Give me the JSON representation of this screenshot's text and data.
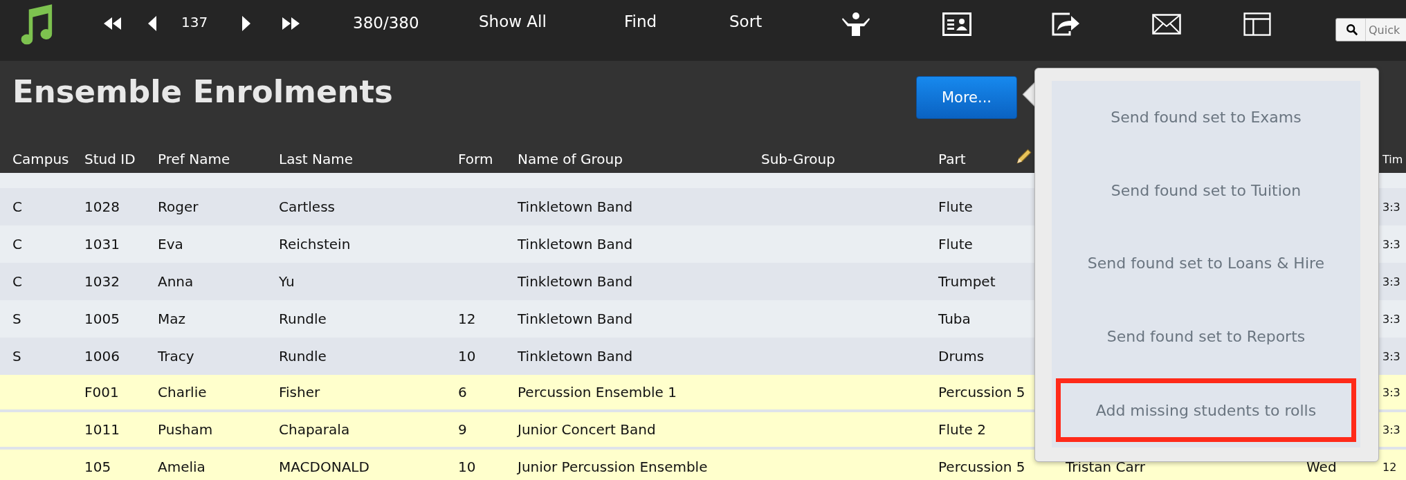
{
  "toolbar": {
    "record_number": "137",
    "record_count": "380/380",
    "buttons": [
      {
        "label": "Show All"
      },
      {
        "label": "Find"
      },
      {
        "label": "Sort"
      }
    ],
    "search": {
      "placeholder": "Quick"
    }
  },
  "header": {
    "title": "Ensemble Enrolments",
    "more_button": "More..."
  },
  "popover": {
    "items": [
      {
        "label": "Send found set to Exams",
        "highlighted": false
      },
      {
        "label": "Send found set to Tuition",
        "highlighted": false
      },
      {
        "label": "Send found set to Loans & Hire",
        "highlighted": false
      },
      {
        "label": "Send found set to Reports",
        "highlighted": false
      },
      {
        "label": "Add missing students to rolls",
        "highlighted": true
      }
    ]
  },
  "table": {
    "columns": [
      {
        "label": "Campus"
      },
      {
        "label": "Stud ID"
      },
      {
        "label": "Pref Name"
      },
      {
        "label": "Last Name"
      },
      {
        "label": "Form"
      },
      {
        "label": "Name of Group"
      },
      {
        "label": "Sub-Group"
      },
      {
        "label": "Part"
      },
      {
        "label": "Tim"
      }
    ],
    "rows": [
      {
        "flagged": false,
        "campus": "C",
        "stud_id": "1028",
        "pref_name": "Roger",
        "last_name": "Cartless",
        "group": "Tinkletown Band",
        "part": "Flute",
        "column_11": "3:3"
      },
      {
        "flagged": false,
        "campus": "C",
        "stud_id": "1031",
        "pref_name": "Eva",
        "last_name": "Reichstein",
        "group": "Tinkletown Band",
        "part": "Flute",
        "column_11": "3:3"
      },
      {
        "flagged": false,
        "campus": "C",
        "stud_id": "1032",
        "pref_name": "Anna",
        "last_name": "Yu",
        "group": "Tinkletown Band",
        "part": "Trumpet",
        "column_11": "3:3"
      },
      {
        "flagged": false,
        "campus": "S",
        "stud_id": "1005",
        "pref_name": "Maz",
        "last_name": "Rundle",
        "form": "12",
        "group": "Tinkletown Band",
        "part": "Tuba",
        "column_11": "3:3"
      },
      {
        "flagged": false,
        "campus": "S",
        "stud_id": "1006",
        "pref_name": "Tracy",
        "last_name": "Rundle",
        "form": "10",
        "group": "Tinkletown Band",
        "part": "Drums",
        "column_11": "3:3"
      },
      {
        "flagged": true,
        "stud_id": "F001",
        "pref_name": "Charlie",
        "last_name": "Fisher",
        "form": "6",
        "group": "Percussion Ensemble 1",
        "part": "Percussion 5",
        "column_11": "3:3"
      },
      {
        "flagged": true,
        "stud_id": "1011",
        "pref_name": "Pusham",
        "last_name": "Chaparala",
        "form": "9",
        "group": "Junior Concert Band",
        "part": "Flute 2",
        "column_11": "3:3"
      },
      {
        "flagged": true,
        "stud_id": "105",
        "pref_name": "Amelia",
        "last_name": "MACDONALD",
        "form": "10",
        "group": "Junior Percussion Ensemble",
        "part": "Percussion 5",
        "column_9": "Tristan Carr",
        "column_10": "Wed",
        "column_11": "12"
      }
    ]
  }
}
